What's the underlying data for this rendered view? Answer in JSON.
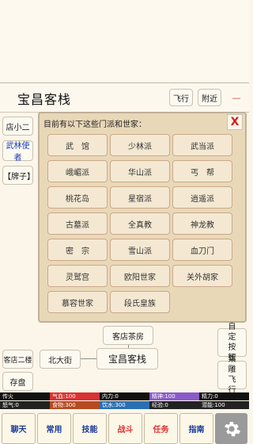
{
  "header": {
    "title": "宝昌客栈",
    "fly_label": "飞行",
    "nearby_label": "附近",
    "collapse_symbol": "—"
  },
  "left_panel": {
    "npc1": "店小二",
    "npc2": "武林使者",
    "sign": "【牌子】",
    "exit_up": "客店二楼",
    "save": "存盘"
  },
  "sect_dialog": {
    "prompt": "目前有以下这些门派和世家：",
    "close_label": "X",
    "sects": [
      "武　馆",
      "少林派",
      "武当派",
      "峨嵋派",
      "华山派",
      "丐　帮",
      "桃花岛",
      "星宿派",
      "逍遥派",
      "古墓派",
      "全真教",
      "神龙教",
      "密　宗",
      "雪山派",
      "血刀门",
      "灵鹫宫",
      "欧阳世家",
      "关外胡家",
      "慕容世家",
      "段氏皇族"
    ]
  },
  "map": {
    "north": "客店茶房",
    "west": "北大街",
    "center": "宝昌客栈",
    "custom_btn": "自定按钮",
    "ride_btn": "乘雕飞行"
  },
  "stats": [
    {
      "label": "传火",
      "pct": 0,
      "color": "#d83232",
      "bg": "#111"
    },
    {
      "label": "气血:100",
      "pct": 1,
      "color": "#d83232",
      "bg": "#111"
    },
    {
      "label": "内力:0",
      "pct": 0,
      "color": "#3a62c8",
      "bg": "#111"
    },
    {
      "label": "精神:100",
      "pct": 1,
      "color": "#8a5bc8",
      "bg": "#111"
    },
    {
      "label": "精力:0",
      "pct": 0,
      "color": "#e0a020",
      "bg": "#111"
    },
    {
      "label": "怒气:0",
      "pct": 0,
      "color": "#888",
      "bg": "#222"
    },
    {
      "label": "食物:300",
      "pct": 1,
      "color": "#b54b20",
      "bg": "#222"
    },
    {
      "label": "饮水:300",
      "pct": 1,
      "color": "#2a6fb5",
      "bg": "#222"
    },
    {
      "label": "经验:0",
      "pct": 0,
      "color": "#3b8a3b",
      "bg": "#222"
    },
    {
      "label": "潜能:100",
      "pct": 0,
      "color": "#aaa",
      "bg": "#222"
    }
  ],
  "nav": {
    "chat": "聊天",
    "common": "常用",
    "skills": "技能",
    "combat": "战斗",
    "quest": "任务",
    "guide": "指南"
  }
}
